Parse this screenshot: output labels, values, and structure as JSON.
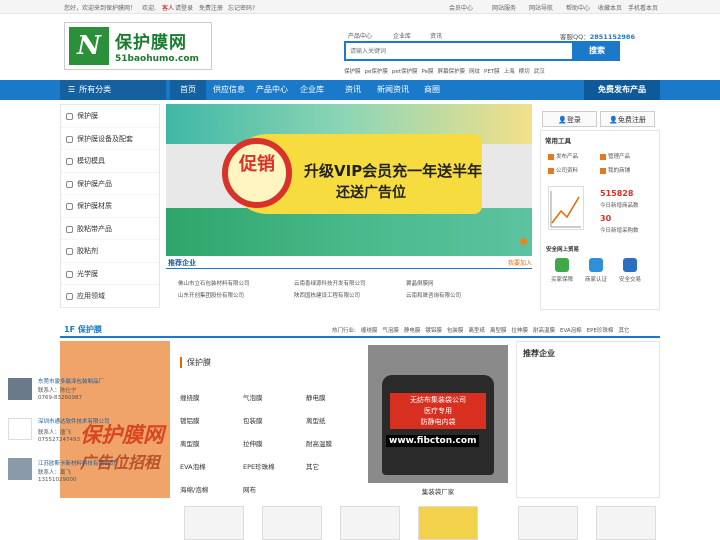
{
  "topbar": {
    "welcome": "您好，欢迎来到保护膜网！",
    "greet": "欢迎,",
    "guest": "客人",
    "login": "请登录",
    "register": "免费注册",
    "forgot": "忘记密码?",
    "right": [
      "会员中心",
      "网站服务",
      "网站导航",
      "帮助中心",
      "收藏本页",
      "手机看本页"
    ]
  },
  "logo": {
    "name": "保护膜网",
    "url": "51baohumo.com"
  },
  "search": {
    "tabs": [
      "产品中心",
      "企业库",
      "资讯"
    ],
    "placeholder": "请输入关键词",
    "button": "搜索",
    "hotwords": [
      "保护膜",
      "pe保护膜",
      "pet保护膜",
      "Pe膜",
      "屏幕保护膜",
      "网纹",
      "PET膜",
      "上海",
      "横切",
      "武汉"
    ]
  },
  "qq": {
    "label": "客服QQ：",
    "number": "2851152986"
  },
  "nav": {
    "all": "所有分类",
    "items": [
      "首页",
      "供应信息",
      "产品中心",
      "企业库",
      "资讯",
      "新闻资讯",
      "商圈"
    ],
    "publish": "免费发布产品"
  },
  "sidebar": [
    "保护膜",
    "保护膜设备及配套",
    "模切模具",
    "保护膜产品",
    "保护膜材质",
    "胶粘带产品",
    "胶粘剂",
    "光学膜",
    "应用领域"
  ],
  "banner": {
    "seal": "促销",
    "line1": "升级VIP会员充一年送半年",
    "line2": "还送广告位"
  },
  "recommend": {
    "title": "推荐企业",
    "more": "我要加入",
    "companies": [
      "佛山市立石包装材料有限公司",
      "云南香绿源科技开发有限公司",
      "翼晶倒膜网",
      "山东开创集团股份有限公司",
      "陕西国栋建设工程有限公司",
      "云南和晟咨询有限公司"
    ]
  },
  "account": {
    "login": "登录",
    "register": "免费注册"
  },
  "tools": {
    "title": "常用工具",
    "items": [
      "发布产品",
      "管理产品",
      "公司资料",
      "我的商铺"
    ]
  },
  "stats": [
    {
      "value": "515828",
      "label": "今日新增商品数"
    },
    {
      "value": "30",
      "label": "今日新增采购数"
    }
  ],
  "safety": {
    "title": "安全网上贸易",
    "items": [
      "买家保障",
      "商家认证",
      "安全交易"
    ]
  },
  "floor": {
    "title": "1F 保护膜",
    "hot_label": "热门行业:",
    "hot": [
      "缠绕膜",
      "气泡膜",
      "静电膜",
      "镀铝膜",
      "包装膜",
      "离型纸",
      "离型膜",
      "拉伸膜",
      "耐高温膜",
      "EVA泡棉",
      "EPE珍珠棉",
      "其它"
    ]
  },
  "ad": {
    "line1": "保护膜网",
    "line2": "广告位招租"
  },
  "category_box": {
    "title": "保护膜",
    "items": [
      "缠绕膜",
      "气泡膜",
      "静电膜",
      "镀铝膜",
      "包装膜",
      "离型纸",
      "离型膜",
      "拉伸膜",
      "耐高温膜",
      "EVA泡棉",
      "EPE珍珠棉",
      "其它",
      "海绵/泡棉",
      "网布"
    ]
  },
  "product": {
    "label": "无纺布集装袋公司\n医疗专用\n防静电内袋",
    "site": "www.fibcton.com",
    "caption": "集装袋厂家"
  },
  "recent": {
    "title": "推荐企业",
    "companies": [
      {
        "name": "东莞市骏多赢泽包装制品厂",
        "contact": "联系人：陈仕宁",
        "phone": "0769-83260987"
      },
      {
        "name": "深圳市通达软件技术有限公司",
        "contact": "联系人：唐飞",
        "phone": "075527247493"
      },
      {
        "name": "江苏欧斯卡新材料科技有限公司",
        "contact": "联系人：葛飞",
        "phone": "13151029000"
      }
    ]
  }
}
